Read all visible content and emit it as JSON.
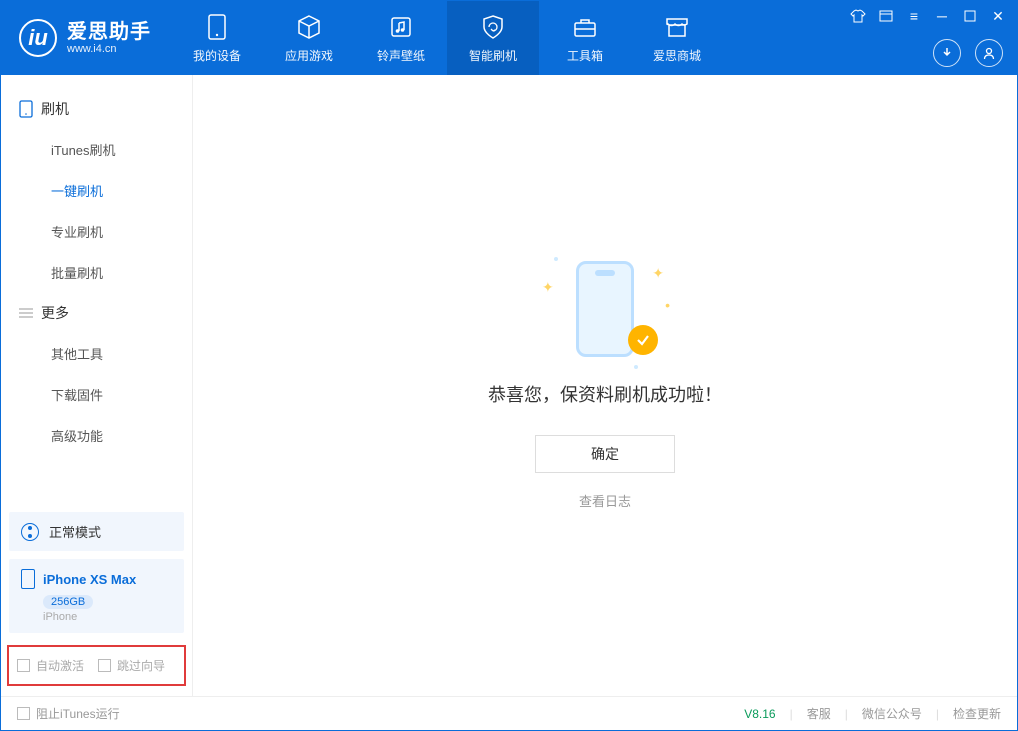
{
  "header": {
    "logo_title": "爱思助手",
    "logo_sub": "www.i4.cn",
    "tabs": [
      {
        "label": "我的设备"
      },
      {
        "label": "应用游戏"
      },
      {
        "label": "铃声壁纸"
      },
      {
        "label": "智能刷机"
      },
      {
        "label": "工具箱"
      },
      {
        "label": "爱思商城"
      }
    ]
  },
  "sidebar": {
    "groups": [
      {
        "title": "刷机",
        "items": [
          "iTunes刷机",
          "一键刷机",
          "专业刷机",
          "批量刷机"
        ]
      },
      {
        "title": "更多",
        "items": [
          "其他工具",
          "下载固件",
          "高级功能"
        ]
      }
    ],
    "mode": "正常模式",
    "device": {
      "name": "iPhone XS Max",
      "storage": "256GB",
      "type": "iPhone"
    },
    "options": [
      "自动激活",
      "跳过向导"
    ]
  },
  "main": {
    "message": "恭喜您，保资料刷机成功啦！",
    "confirm_label": "确定",
    "log_link": "查看日志"
  },
  "footer": {
    "block_itunes": "阻止iTunes运行",
    "version": "V8.16",
    "links": [
      "客服",
      "微信公众号",
      "检查更新"
    ]
  }
}
